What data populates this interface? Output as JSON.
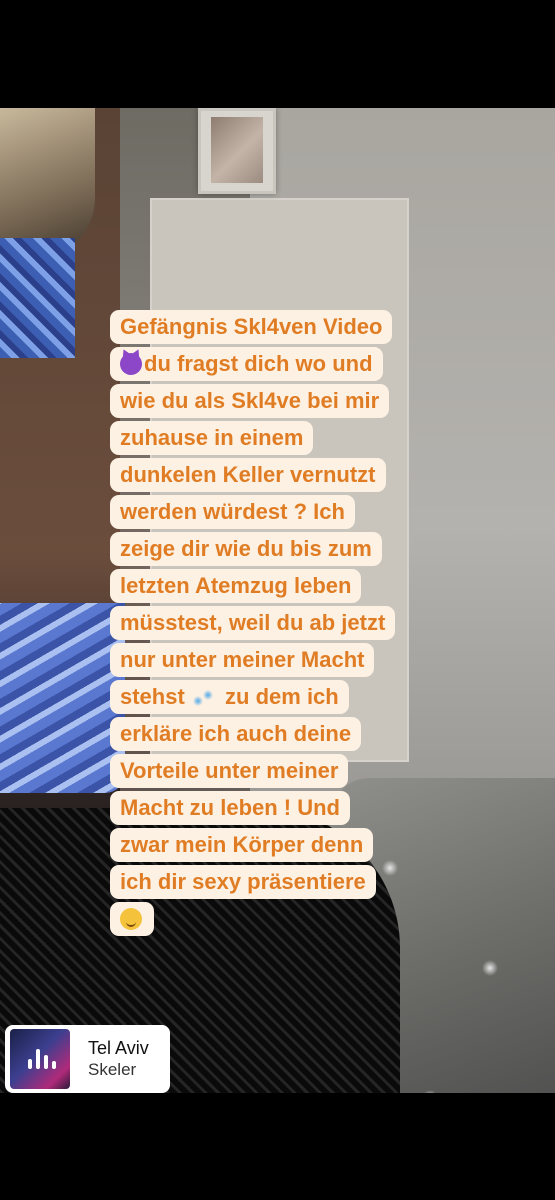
{
  "caption": {
    "lines": [
      "Gefängnis Skl4ven Video",
      "du fragst dich wo und",
      "wie du als Skl4ve  bei mir",
      "zuhause in einem",
      "dunkelen Keller vernutzt",
      "werden würdest ? Ich",
      "zeige dir wie du bis zum",
      "letzten Atemzug leben",
      "müsstest, weil du ab jetzt",
      "nur unter meiner Macht",
      "stehst",
      "zu dem ich",
      "erkläre ich auch deine",
      "Vorteile unter meiner",
      "Macht zu leben ! Und",
      "zwar mein Körper denn",
      "ich dir sexy präsentiere"
    ],
    "emojis": {
      "devil": "purple-devil-face-icon",
      "drops": "sweat-droplets-icon",
      "wink": "winking-face-icon"
    },
    "colors": {
      "text": "#e07d24",
      "background": "#fdf1e3"
    }
  },
  "music_sticker": {
    "title": "Tel Aviv",
    "artist": "Skeler",
    "icon": "audio-waveform-icon"
  }
}
